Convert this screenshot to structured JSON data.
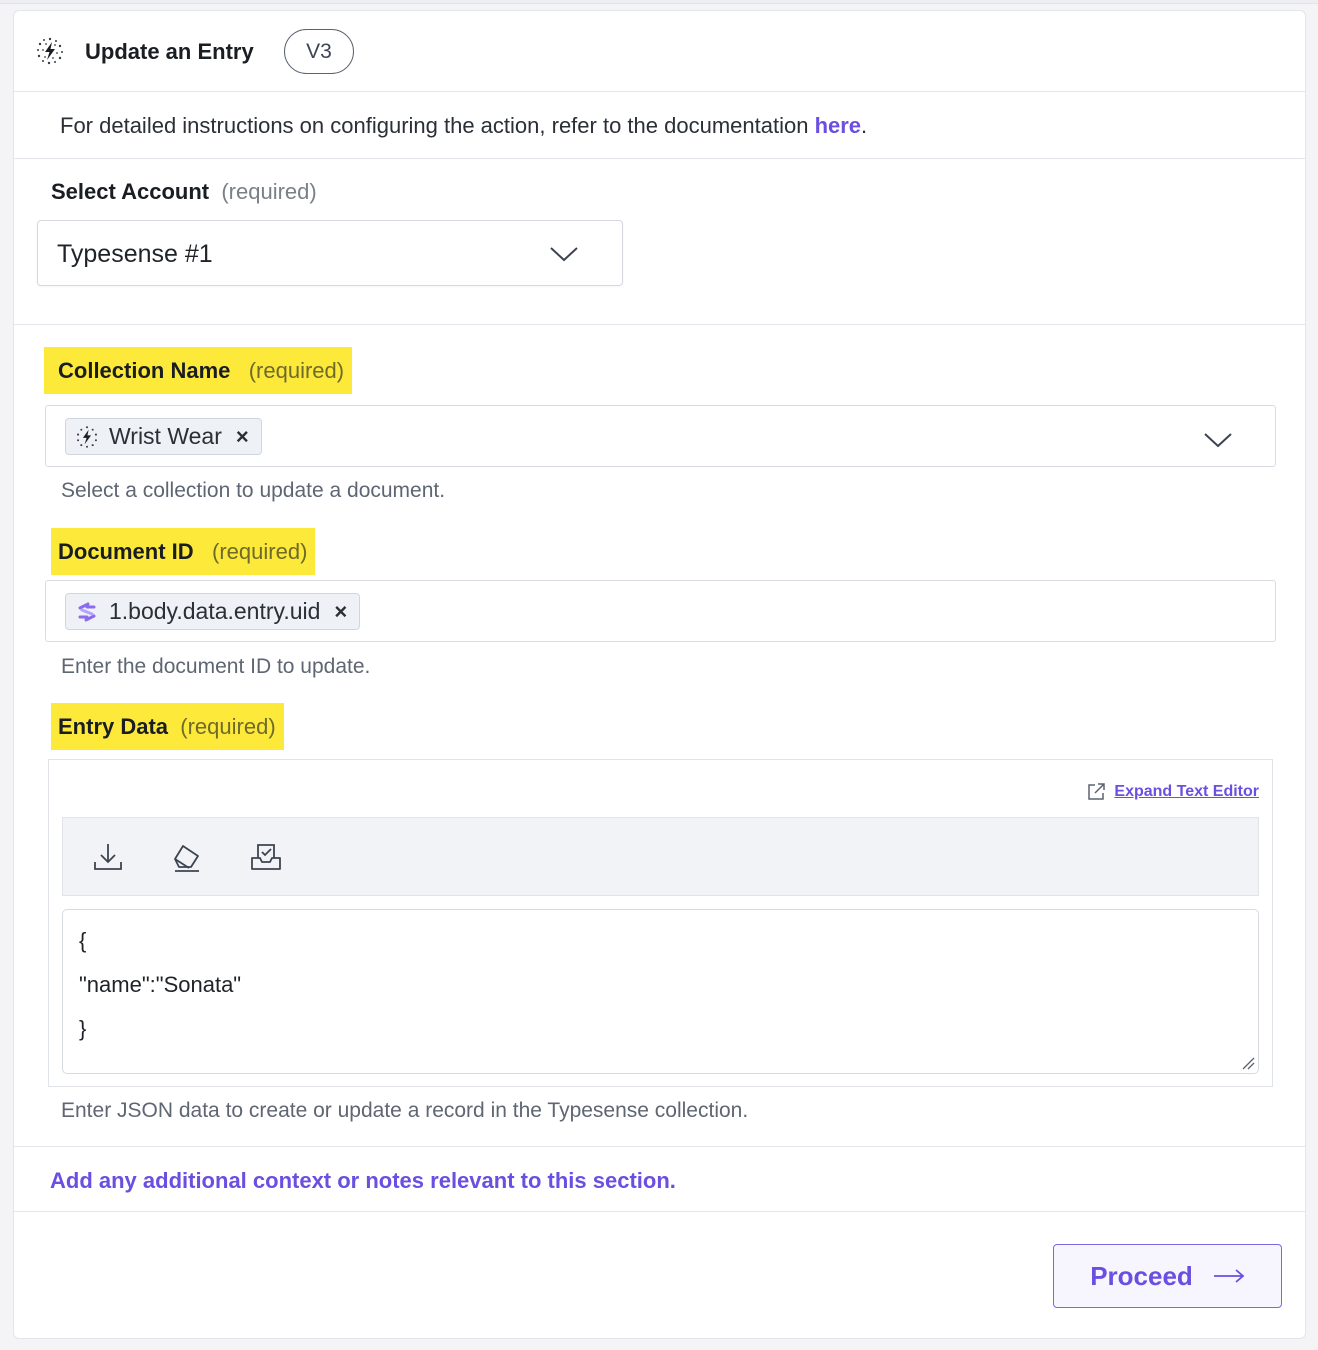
{
  "header": {
    "title": "Update an Entry",
    "version": "V3",
    "app_icon": "typesense-logo-icon"
  },
  "info": {
    "text": "For detailed instructions on configuring the action, refer to the documentation ",
    "link_label": "here",
    "suffix": "."
  },
  "account": {
    "label": "Select Account",
    "required": "(required)",
    "value": "Typesense #1"
  },
  "collection": {
    "label": "Collection Name",
    "required": "(required)",
    "chip_label": "Wrist Wear",
    "chip_remove": "×",
    "help": "Select a collection to update a document."
  },
  "document": {
    "label": "Document ID",
    "required": "(required)",
    "chip_label": "1.body.data.entry.uid",
    "chip_remove": "×",
    "help": "Enter the document ID to update."
  },
  "entry": {
    "label": "Entry Data",
    "required": "(required)",
    "expand_label": "Expand Text Editor",
    "toolbar_icons": [
      "download-icon",
      "eraser-icon",
      "inbox-check-icon"
    ],
    "code_lines": [
      "{",
      "\"name\":\"Sonata\"",
      "}"
    ],
    "help": "Enter JSON data to create or update a record in the Typesense collection."
  },
  "notes": {
    "text": "Add any additional context or notes relevant to this section."
  },
  "footer": {
    "proceed_label": "Proceed"
  },
  "colors": {
    "accent": "#6a4fe0",
    "highlight": "#fde93a",
    "border": "#e3e5ea"
  }
}
